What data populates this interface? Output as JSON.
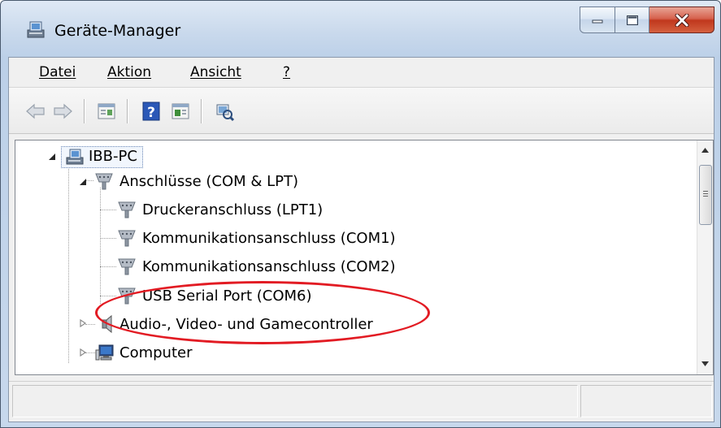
{
  "window": {
    "title": "Geräte-Manager",
    "icon": "device-manager-icon",
    "caption_buttons": [
      "minimize-icon",
      "maximize-icon",
      "close-icon"
    ]
  },
  "menu": {
    "items": [
      {
        "label": "Datei"
      },
      {
        "label": "Aktion"
      },
      {
        "label": "Ansicht"
      },
      {
        "label": "?"
      }
    ]
  },
  "toolbar": {
    "buttons": [
      "back-arrow-icon",
      "forward-arrow-icon",
      "properties-icon",
      "help-icon",
      "action-pane-icon",
      "scan-hardware-icon"
    ]
  },
  "tree": {
    "root": {
      "label": "IBB-PC",
      "icon": "computer-network-icon"
    },
    "category_ports": {
      "label": "Anschlüsse (COM & LPT)",
      "icon": "port-connector-icon",
      "expanded": true
    },
    "devices": [
      {
        "label": "Druckeranschluss (LPT1)",
        "icon": "port-connector-icon"
      },
      {
        "label": "Kommunikationsanschluss (COM1)",
        "icon": "port-connector-icon"
      },
      {
        "label": "Kommunikationsanschluss (COM2)",
        "icon": "port-connector-icon"
      },
      {
        "label": "USB Serial Port (COM6)",
        "icon": "port-connector-icon",
        "highlighted": true
      }
    ],
    "category_audio": {
      "label": "Audio-, Video- und Gamecontroller",
      "icon": "speaker-icon",
      "expanded": false
    },
    "category_computer": {
      "label": "Computer",
      "icon": "monitor-icon",
      "expanded": false
    }
  },
  "colors": {
    "annotation": "#e21b23",
    "titlebar": "#c9d9ec",
    "close_button": "#c0371c",
    "selection_border": "#6a86b5"
  }
}
